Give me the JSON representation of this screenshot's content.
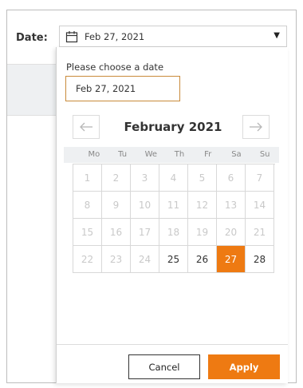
{
  "field": {
    "label": "Date:",
    "value": "Feb 27, 2021",
    "calendar_icon": "calendar-icon",
    "dropdown_icon": "caret-down-icon"
  },
  "popup": {
    "prompt": "Please choose a date",
    "input_value": "Feb 27, 2021",
    "month_title": "February 2021",
    "prev_icon": "arrow-left-icon",
    "next_icon": "arrow-right-icon",
    "weekdays": [
      "Mo",
      "Tu",
      "We",
      "Th",
      "Fr",
      "Sa",
      "Su"
    ],
    "days": [
      {
        "label": "1",
        "state": "disabled"
      },
      {
        "label": "2",
        "state": "disabled"
      },
      {
        "label": "3",
        "state": "disabled"
      },
      {
        "label": "4",
        "state": "disabled"
      },
      {
        "label": "5",
        "state": "disabled"
      },
      {
        "label": "6",
        "state": "disabled"
      },
      {
        "label": "7",
        "state": "disabled"
      },
      {
        "label": "8",
        "state": "disabled"
      },
      {
        "label": "9",
        "state": "disabled"
      },
      {
        "label": "10",
        "state": "disabled"
      },
      {
        "label": "11",
        "state": "disabled"
      },
      {
        "label": "12",
        "state": "disabled"
      },
      {
        "label": "13",
        "state": "disabled"
      },
      {
        "label": "14",
        "state": "disabled"
      },
      {
        "label": "15",
        "state": "disabled"
      },
      {
        "label": "16",
        "state": "disabled"
      },
      {
        "label": "17",
        "state": "disabled"
      },
      {
        "label": "18",
        "state": "disabled"
      },
      {
        "label": "19",
        "state": "disabled"
      },
      {
        "label": "20",
        "state": "disabled"
      },
      {
        "label": "21",
        "state": "disabled"
      },
      {
        "label": "22",
        "state": "disabled"
      },
      {
        "label": "23",
        "state": "disabled"
      },
      {
        "label": "24",
        "state": "disabled"
      },
      {
        "label": "25",
        "state": "enabled"
      },
      {
        "label": "26",
        "state": "enabled"
      },
      {
        "label": "27",
        "state": "selected"
      },
      {
        "label": "28",
        "state": "enabled"
      }
    ],
    "cancel_label": "Cancel",
    "apply_label": "Apply"
  },
  "colors": {
    "accent": "#ee7a12",
    "input_border": "#c98a3a"
  }
}
